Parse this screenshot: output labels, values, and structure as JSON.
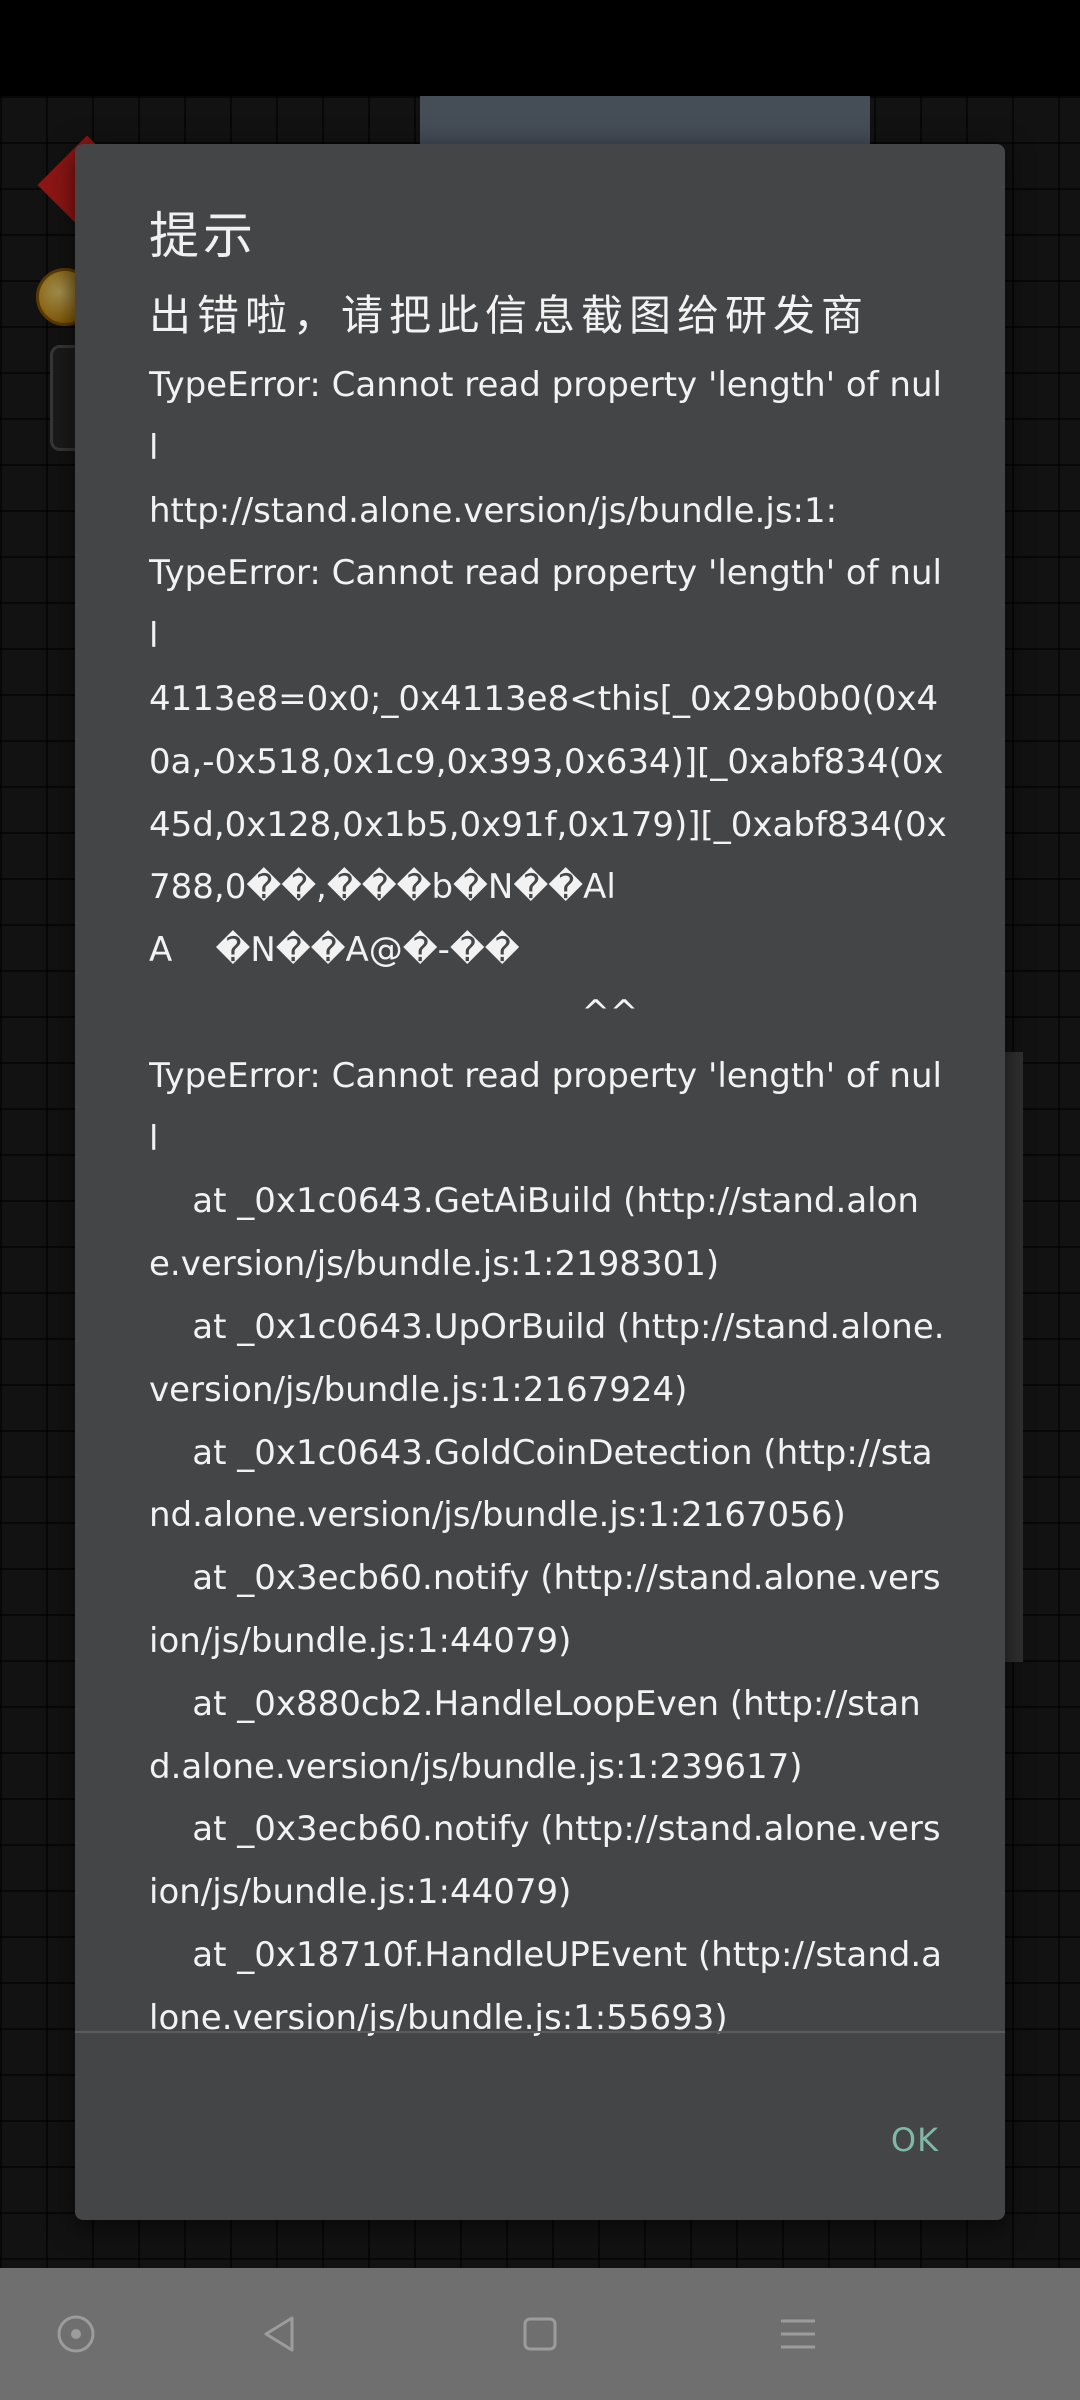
{
  "dialog": {
    "title": "提示",
    "message": "出错啦，请把此信息截图给研发商",
    "error_details": "TypeError: Cannot read property 'length' of null\nhttp://stand.alone.version/js/bundle.js:1:\nTypeError: Cannot read property 'length' of null\n4113e8=0x0;_0x4113e8<this[_0x29b0b0(0x40a,-0x518,0x1c9,0x393,0x634)][_0xabf834(0x45d,0x128,0x1b5,0x91f,0x179)][_0xabf834(0x788,0��,���b�N��Al\nA    �N��A@�-��\n                                        ^^\nTypeError: Cannot read property 'length' of null\n    at _0x1c0643.GetAiBuild (http://stand.alone.version/js/bundle.js:1:2198301)\n    at _0x1c0643.UpOrBuild (http://stand.alone.version/js/bundle.js:1:2167924)\n    at _0x1c0643.GoldCoinDetection (http://stand.alone.version/js/bundle.js:1:2167056)\n    at _0x3ecb60.notify (http://stand.alone.version/js/bundle.js:1:44079)\n    at _0x880cb2.HandleLoopEven (http://stand.alone.version/js/bundle.js:1:239617)\n    at _0x3ecb60.notify (http://stand.alone.version/js/bundle.js:1:44079)\n    at _0x18710f.HandleUPEvent (http://stand.alone.version/js/bundle.js:1:55693)",
    "ok_label": "OK"
  },
  "nav_bar": {
    "buttons": [
      {
        "icon": "assistant-dot-icon"
      },
      {
        "icon": "back-triangle-icon"
      },
      {
        "icon": "home-square-icon"
      },
      {
        "icon": "menu-lines-icon"
      }
    ]
  },
  "colors": {
    "dialog_bg": "#444546",
    "ok_accent": "#7fb8a8",
    "nav_bar_bg": "#6f6f6f"
  }
}
